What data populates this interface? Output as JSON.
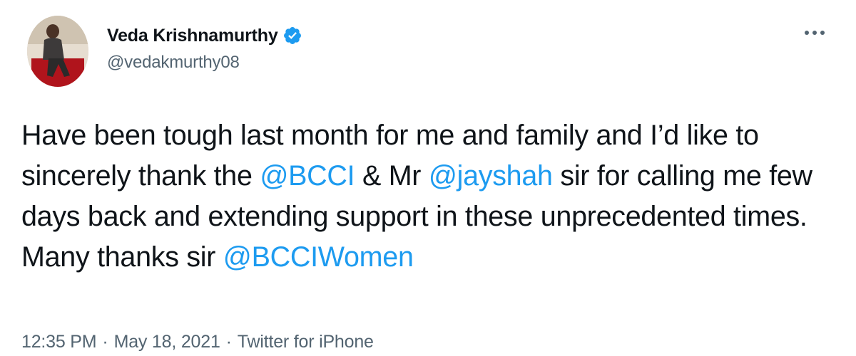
{
  "author": {
    "display_name": "Veda Krishnamurthy",
    "handle": "@vedakmurthy08",
    "verified_icon": "verified-badge-icon",
    "avatar": "profile-photo"
  },
  "more_icon": "more-horizontal-icon",
  "tweet": {
    "segments": [
      {
        "type": "text",
        "text": "Have been tough last month for me and family and I’d like to sincerely thank the "
      },
      {
        "type": "mention",
        "text": "@BCCI"
      },
      {
        "type": "text",
        "text": " & Mr "
      },
      {
        "type": "mention",
        "text": "@jayshah"
      },
      {
        "type": "text",
        "text": " sir for calling me few days back and extending support in these unprecedented times. Many thanks sir "
      },
      {
        "type": "mention",
        "text": "@BCCIWomen"
      }
    ]
  },
  "meta": {
    "time": "12:35 PM",
    "separator": "·",
    "date": "May 18, 2021",
    "source": "Twitter for iPhone"
  },
  "colors": {
    "mention": "#1d9bf0",
    "secondary_text": "#536471",
    "verified": "#1d9bf0"
  }
}
